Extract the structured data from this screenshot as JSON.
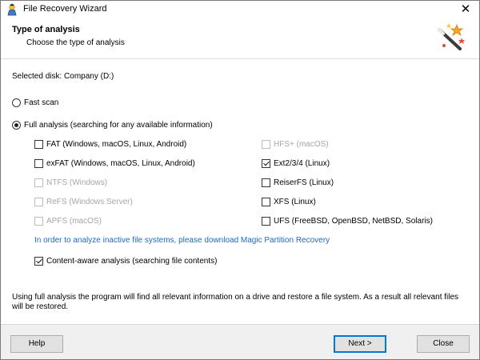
{
  "window": {
    "title": "File Recovery Wizard",
    "close_glyph": "✕"
  },
  "header": {
    "title": "Type of analysis",
    "subtitle": "Choose the type of analysis"
  },
  "disk_label": "Selected disk: Company (D:)",
  "options": {
    "fast_scan": {
      "label": "Fast scan",
      "selected": false
    },
    "full_analysis": {
      "label": "Full analysis (searching for any available information)",
      "selected": true
    }
  },
  "filesystems_left": [
    {
      "label": "FAT (Windows, macOS, Linux, Android)",
      "checked": false,
      "enabled": true
    },
    {
      "label": "exFAT (Windows, macOS, Linux, Android)",
      "checked": false,
      "enabled": true
    },
    {
      "label": "NTFS (Windows)",
      "checked": false,
      "enabled": false
    },
    {
      "label": "ReFS (Windows Server)",
      "checked": false,
      "enabled": false
    },
    {
      "label": "APFS (macOS)",
      "checked": false,
      "enabled": false
    }
  ],
  "filesystems_right": [
    {
      "label": "HFS+ (macOS)",
      "checked": false,
      "enabled": false
    },
    {
      "label": "Ext2/3/4 (Linux)",
      "checked": true,
      "enabled": true
    },
    {
      "label": "ReiserFS (Linux)",
      "checked": false,
      "enabled": true
    },
    {
      "label": "XFS (Linux)",
      "checked": false,
      "enabled": true
    },
    {
      "label": "UFS (FreeBSD, OpenBSD, NetBSD, Solaris)",
      "checked": false,
      "enabled": true
    }
  ],
  "link_text": "In order to analyze inactive file systems, please download Magic Partition Recovery",
  "content_aware": {
    "label": "Content-aware analysis (searching file contents)",
    "checked": true
  },
  "note": "Using full analysis the program will find all relevant information on a drive and restore a file system. As a result all relevant files will be restored.",
  "buttons": {
    "help": "Help",
    "next": "Next >",
    "close": "Close"
  },
  "colors": {
    "link": "#1e69c8",
    "primary_border": "#0078d7",
    "disabled_text": "#a6a6a6"
  },
  "icons": {
    "app": "recovery-wizard-icon",
    "header": "magic-wand-icon"
  }
}
